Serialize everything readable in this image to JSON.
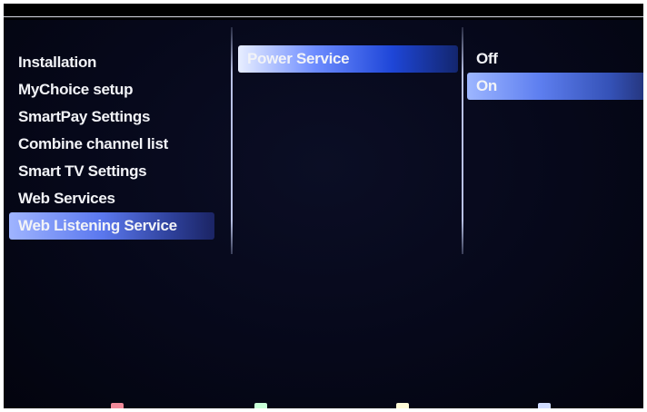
{
  "menu": {
    "column1": {
      "items": [
        {
          "label": "Installation"
        },
        {
          "label": "MyChoice setup"
        },
        {
          "label": "SmartPay Settings"
        },
        {
          "label": "Combine channel list"
        },
        {
          "label": "Smart TV Settings"
        },
        {
          "label": "Web Services"
        },
        {
          "label": "Web Listening Service"
        }
      ],
      "selected_index": 6
    },
    "column2": {
      "items": [
        {
          "label": "Power Service"
        }
      ],
      "selected_index": 0
    },
    "column3": {
      "items": [
        {
          "label": "Off"
        },
        {
          "label": "On"
        }
      ],
      "selected_index": 1
    }
  },
  "color_keys": [
    {
      "icon": "red-key-icon",
      "color": "#f08a9a"
    },
    {
      "icon": "green-key-icon",
      "color": "#c8ffd8"
    },
    {
      "icon": "yellow-key-icon",
      "color": "#fffad8"
    },
    {
      "icon": "blue-key-icon",
      "color": "#d0dcff"
    }
  ],
  "theme": {
    "accent": "#4e6ee8",
    "background": "#06081a"
  }
}
